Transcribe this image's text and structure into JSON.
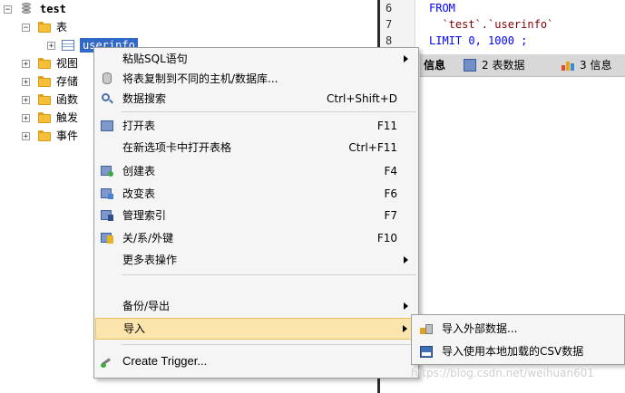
{
  "tree": {
    "database": "test",
    "tables_folder": "表",
    "selected_table": "userinfo",
    "folders": [
      "视图",
      "存储",
      "函数",
      "触发",
      "事件"
    ]
  },
  "editor": {
    "line_numbers": [
      "6",
      "7",
      "8"
    ],
    "line6": "FROM",
    "line7": "  `test`.`userinfo`",
    "line8": "LIMIT 0, 1000 ;"
  },
  "tabs": [
    {
      "label": "信息"
    },
    {
      "label": "2 表数据"
    },
    {
      "label": "3 信息"
    }
  ],
  "context_menu": {
    "items": [
      {
        "label": "粘贴SQL语句",
        "shortcut": "",
        "submenu": true
      },
      {
        "label": "将表复制到不同的主机/数据库...",
        "shortcut": "",
        "submenu": false
      },
      {
        "label": "数据搜索",
        "shortcut": "Ctrl+Shift+D",
        "submenu": false
      },
      {
        "label": "打开表",
        "shortcut": "F11",
        "submenu": false
      },
      {
        "label": "在新选项卡中打开表格",
        "shortcut": "Ctrl+F11",
        "submenu": false
      },
      {
        "label": "创建表",
        "shortcut": "F4",
        "submenu": false
      },
      {
        "label": "改变表",
        "shortcut": "F6",
        "submenu": false
      },
      {
        "label": "管理索引",
        "shortcut": "F7",
        "submenu": false
      },
      {
        "label": "关/系/外键",
        "shortcut": "F10",
        "submenu": false
      },
      {
        "label": "更多表操作",
        "shortcut": "",
        "submenu": true
      },
      {
        "label": "备份/导出",
        "shortcut": "",
        "submenu": true
      },
      {
        "label": "导入",
        "shortcut": "",
        "submenu": true
      },
      {
        "label": "Create Trigger...",
        "shortcut": "",
        "submenu": false
      }
    ]
  },
  "import_submenu": {
    "items": [
      {
        "label": "导入外部数据..."
      },
      {
        "label": "导入使用本地加载的CSV数据"
      }
    ]
  },
  "watermark": "https://blog.csdn.net/weihuan601",
  "colors": {
    "highlight": "#fbe5ad",
    "selection": "#3169c6",
    "sql_keyword": "#0000ff",
    "sql_string": "#800000"
  }
}
